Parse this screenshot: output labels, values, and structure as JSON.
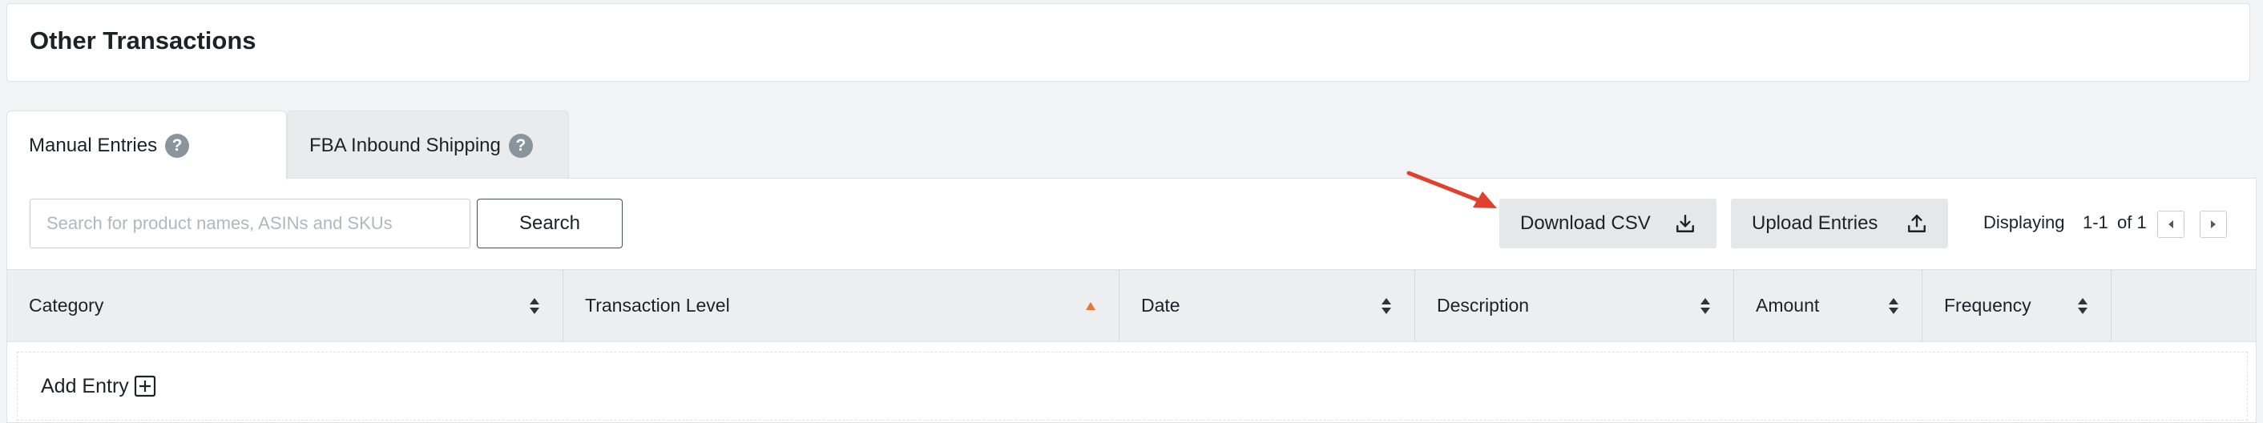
{
  "page": {
    "title": "Other Transactions"
  },
  "tabs": [
    {
      "label": "Manual Entries",
      "help": "?",
      "active": true
    },
    {
      "label": "FBA Inbound Shipping",
      "help": "?",
      "active": false
    }
  ],
  "toolbar": {
    "search_placeholder": "Search for product names, ASINs and SKUs",
    "search_value": "",
    "search_label": "Search",
    "download_label": "Download CSV",
    "download_icon": "download-icon",
    "upload_label": "Upload Entries",
    "upload_icon": "upload-icon"
  },
  "pager": {
    "displaying_label": "Displaying",
    "range": "1-1",
    "of_label": "of 1"
  },
  "table": {
    "columns": [
      {
        "label": "Category",
        "sort": "both"
      },
      {
        "label": "Transaction Level",
        "sort": "asc"
      },
      {
        "label": "Date",
        "sort": "both"
      },
      {
        "label": "Description",
        "sort": "both"
      },
      {
        "label": "Amount",
        "sort": "both"
      },
      {
        "label": "Frequency",
        "sort": "both"
      },
      {
        "label": "",
        "sort": "none"
      }
    ],
    "add_entry_label": "Add Entry"
  },
  "colors": {
    "sort_active": "#e8753a",
    "annotation_arrow": "#e0402d",
    "help_icon_bg": "#8a949d"
  }
}
